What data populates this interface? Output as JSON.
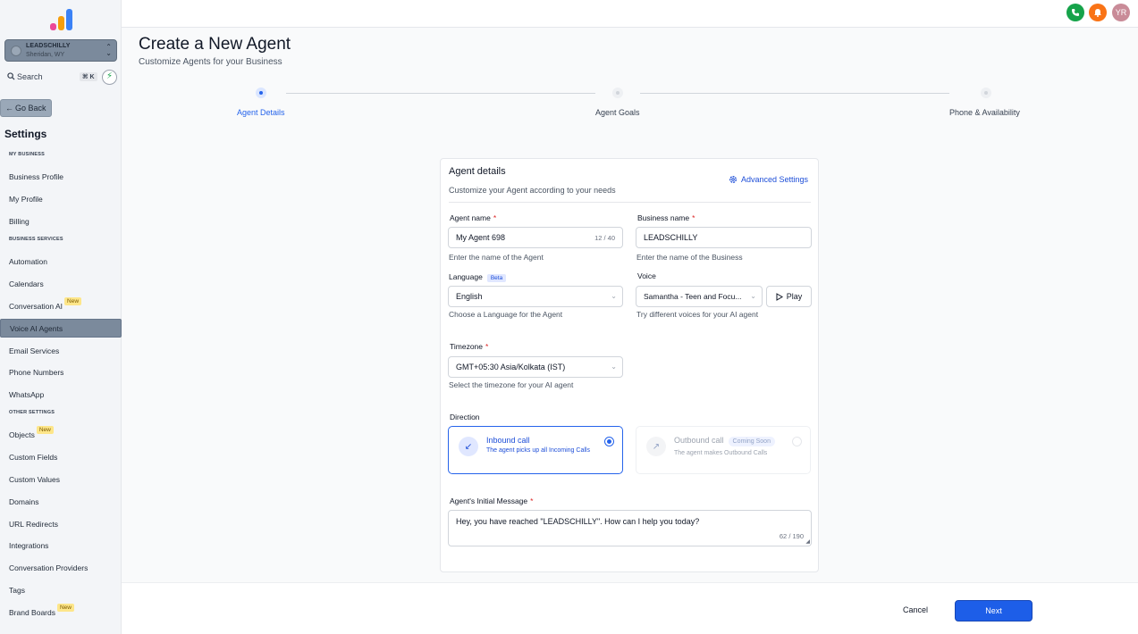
{
  "sidebar": {
    "account": {
      "name": "LEADSCHILLY",
      "location": "Sheridan, WY"
    },
    "search": {
      "label": "Search",
      "shortcut": "⌘ K"
    },
    "go_back": "Go Back",
    "title": "Settings",
    "sections": {
      "my_business": "MY BUSINESS",
      "business_services": "BUSINESS SERVICES",
      "other_settings": "OTHER SETTINGS"
    },
    "items": {
      "business_profile": "Business Profile",
      "my_profile": "My Profile",
      "billing": "Billing",
      "automation": "Automation",
      "calendars": "Calendars",
      "conversation_ai": "Conversation AI",
      "voice_ai_agents": "Voice AI Agents",
      "email_services": "Email Services",
      "phone_numbers": "Phone Numbers",
      "whatsapp": "WhatsApp",
      "objects": "Objects",
      "custom_fields": "Custom Fields",
      "custom_values": "Custom Values",
      "domains": "Domains",
      "url_redirects": "URL Redirects",
      "integrations": "Integrations",
      "conversation_providers": "Conversation Providers",
      "tags": "Tags",
      "brand_boards": "Brand Boards"
    },
    "new_badge": "New"
  },
  "topbar": {
    "avatar_initials": "YR"
  },
  "header": {
    "title": "Create a New Agent",
    "subtitle": "Customize Agents for your Business"
  },
  "stepper": {
    "steps": [
      "Agent Details",
      "Agent Goals",
      "Phone & Availability"
    ],
    "active_index": 0
  },
  "card": {
    "title": "Agent details",
    "subtitle": "Customize your Agent according to your needs",
    "advanced_settings": "Advanced Settings",
    "agent_name": {
      "label": "Agent name",
      "value": "My Agent 698",
      "count": "12 / 40",
      "help": "Enter the name of the Agent"
    },
    "business_name": {
      "label": "Business name",
      "value": "LEADSCHILLY",
      "help": "Enter the name of the Business"
    },
    "language": {
      "label": "Language",
      "badge": "Beta",
      "value": "English",
      "help": "Choose a Language for the Agent"
    },
    "voice": {
      "label": "Voice",
      "value": "Samantha - Teen and Focu...",
      "play": "Play",
      "help": "Try different voices for your AI agent"
    },
    "timezone": {
      "label": "Timezone",
      "value": "GMT+05:30 Asia/Kolkata (IST)",
      "help": "Select the timezone for your AI agent"
    },
    "direction": {
      "label": "Direction",
      "inbound": {
        "title": "Inbound call",
        "desc": "The agent picks up all Incoming Calls"
      },
      "outbound": {
        "title": "Outbound call",
        "badge": "Coming Soon",
        "desc": "The agent makes Outbound Calls"
      }
    },
    "initial_message": {
      "label": "Agent's Initial Message",
      "value": "Hey, you have reached \"LEADSCHILLY\". How can I help you today?",
      "count": "62 / 190"
    },
    "required_mark": "*"
  },
  "footer": {
    "cancel": "Cancel",
    "next": "Next"
  },
  "colors": {
    "primary": "#1d5ee8",
    "phone_green": "#16a34a",
    "bell_orange": "#f97316",
    "avatar": "#c98b98"
  }
}
